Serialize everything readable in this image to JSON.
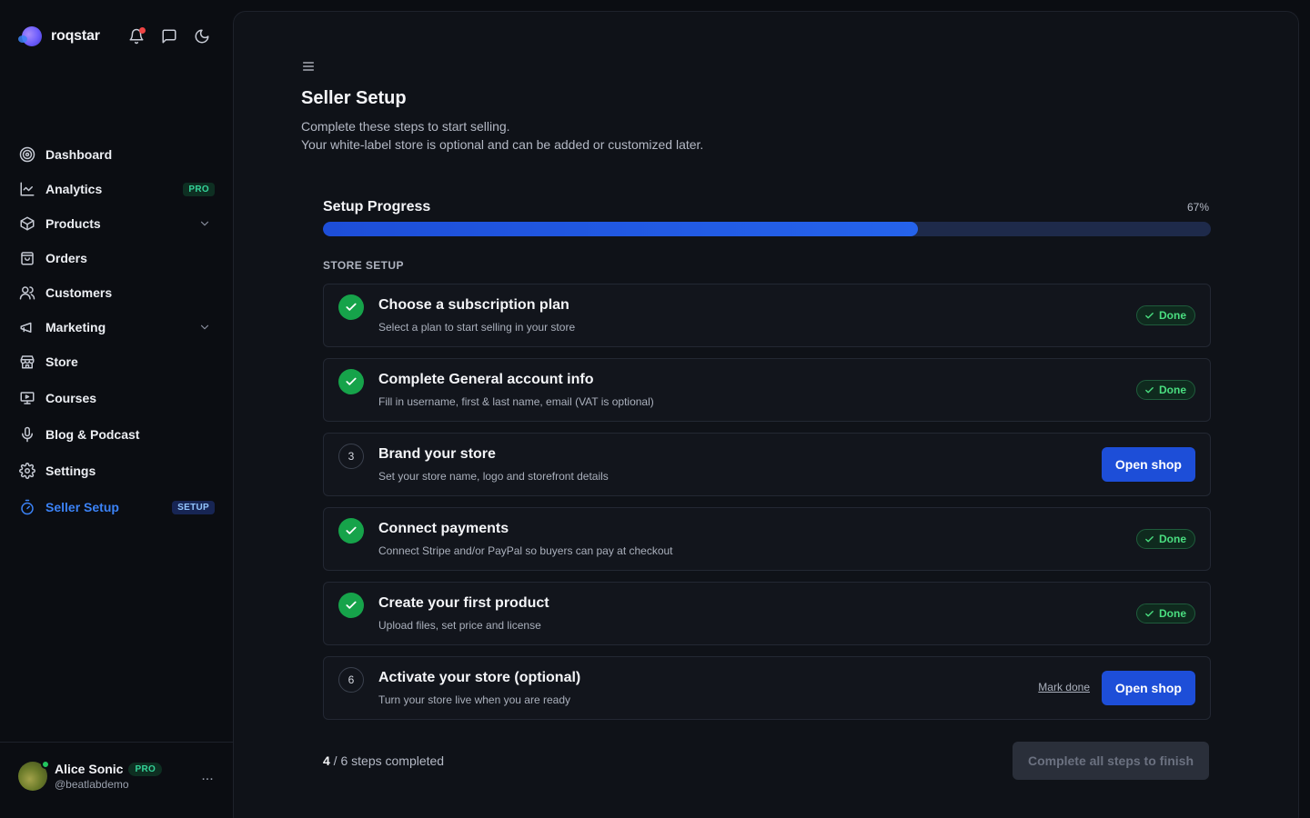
{
  "brand": {
    "name": "roqstar"
  },
  "sidebar": {
    "items": [
      {
        "label": "Dashboard",
        "icon": "dashboard-icon"
      },
      {
        "label": "Analytics",
        "icon": "chart-line-icon",
        "badge": "PRO"
      },
      {
        "label": "Products",
        "icon": "box-icon"
      },
      {
        "label": "Orders",
        "icon": "shopping-bag-icon"
      },
      {
        "label": "Customers",
        "icon": "users-icon"
      },
      {
        "label": "Marketing",
        "icon": "megaphone-icon"
      },
      {
        "label": "Store",
        "icon": "store-icon"
      },
      {
        "label": "Courses",
        "icon": "presentation-icon"
      },
      {
        "label": "Blog & Podcast",
        "icon": "microphone-icon"
      },
      {
        "label": "Settings",
        "icon": "gear-icon"
      },
      {
        "label": "Seller Setup",
        "icon": "timer-icon",
        "badge": "SETUP",
        "active": true
      }
    ]
  },
  "user": {
    "name": "Alice Sonic",
    "badge": "PRO",
    "handle": "@beatlabdemo",
    "more": "..."
  },
  "main": {
    "title": "Seller Setup",
    "subtitle_line1": "Complete these steps to start selling.",
    "subtitle_line2": "Your white-label store is optional and can be added or customized later.",
    "progress": {
      "title": "Setup Progress",
      "percent_label": "67%",
      "value": 0.67
    },
    "section_label": "STORE SETUP",
    "steps": [
      {
        "number": "1",
        "status": "done",
        "title": "Choose a subscription plan",
        "desc": "Select a plan to start selling in your store",
        "badge": "Done"
      },
      {
        "number": "2",
        "status": "done",
        "title": "Complete General account info",
        "desc": "Fill in username, first & last name, email (VAT is optional)",
        "badge": "Done"
      },
      {
        "number": "3",
        "status": "todo",
        "title": "Brand your store",
        "desc": "Set your store name, logo and storefront details",
        "button": "Open shop"
      },
      {
        "number": "4",
        "status": "done",
        "title": "Connect payments",
        "desc": "Connect Stripe and/or PayPal so buyers can pay at checkout",
        "badge": "Done"
      },
      {
        "number": "5",
        "status": "done",
        "title": "Create your first product",
        "desc": "Upload files, set price and license",
        "badge": "Done"
      },
      {
        "number": "6",
        "status": "todo",
        "title": "Activate your store (optional)",
        "desc": "Turn your store live when you are ready",
        "link": "Mark done",
        "button": "Open shop"
      }
    ],
    "completed_count": "4",
    "completed_suffix": " / 6 steps completed",
    "finish_button": "Complete all steps to finish"
  },
  "colors": {
    "accent": "#1d4ed8",
    "success": "#16a34a",
    "background": "#0b0d12",
    "panel": "#0f1218"
  }
}
